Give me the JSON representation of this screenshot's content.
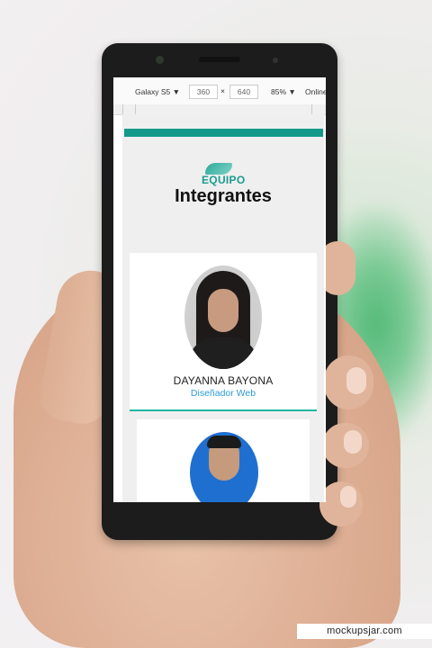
{
  "devtools": {
    "device": "Galaxy S5 ▼",
    "width": "360",
    "times": "×",
    "height": "640",
    "zoom": "85% ▼",
    "status": "Online"
  },
  "page": {
    "logo_text": "EQUIPO",
    "title": "Integrantes"
  },
  "members": [
    {
      "name": "DAYANNA BAYONA",
      "role": "Diseñador Web"
    }
  ],
  "watermark": "mockupsjar.com",
  "colors": {
    "accent_bar": "#15998a",
    "role_text": "#2e9bd6",
    "logo": "#1b9c8f"
  }
}
